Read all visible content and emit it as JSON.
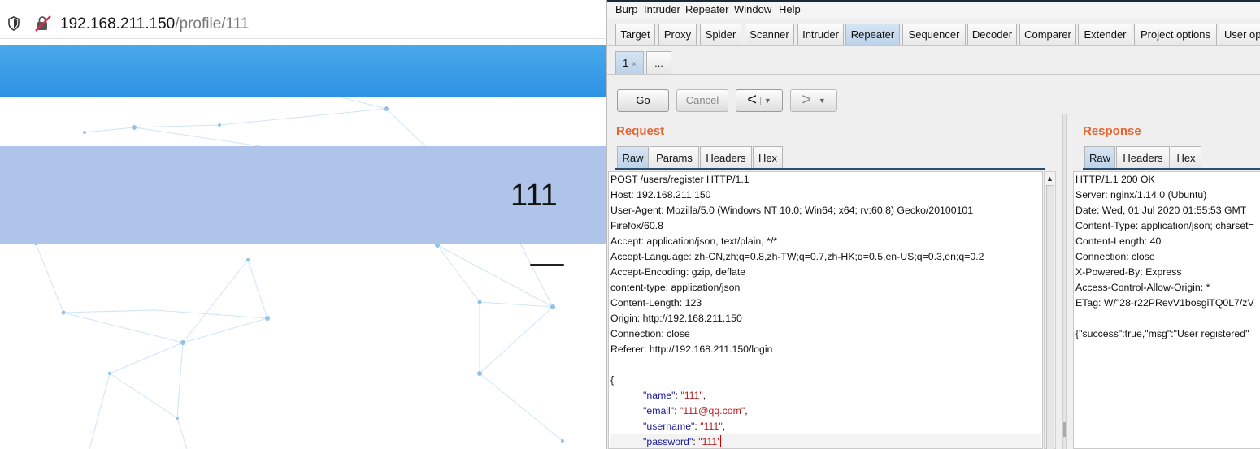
{
  "browser": {
    "url_host": "192.168.211.150",
    "url_path": "/profile/111",
    "profile_name": "111"
  },
  "burp": {
    "menu": [
      "Burp",
      "Intruder",
      "Repeater",
      "Window",
      "Help"
    ],
    "tabs": [
      "Target",
      "Proxy",
      "Spider",
      "Scanner",
      "Intruder",
      "Repeater",
      "Sequencer",
      "Decoder",
      "Comparer",
      "Extender",
      "Project options",
      "User op"
    ],
    "active_tab": "Repeater",
    "repeater_tabs": [
      "1",
      "..."
    ],
    "toolbar": {
      "go": "Go",
      "cancel": "Cancel",
      "back": "<",
      "forward": ">"
    },
    "request": {
      "title": "Request",
      "tabs": [
        "Raw",
        "Params",
        "Headers",
        "Hex"
      ],
      "headers": [
        "POST /users/register HTTP/1.1",
        "Host: 192.168.211.150",
        "User-Agent: Mozilla/5.0 (Windows NT 10.0; Win64; x64; rv:60.8) Gecko/20100101",
        "Firefox/60.8",
        "Accept: application/json, text/plain, */*",
        "Accept-Language: zh-CN,zh;q=0.8,zh-TW;q=0.7,zh-HK;q=0.5,en-US;q=0.3,en;q=0.2",
        "Accept-Encoding: gzip, deflate",
        "content-type: application/json",
        "Content-Length: 123",
        "Origin: http://192.168.211.150",
        "Connection: close",
        "Referer: http://192.168.211.150/login"
      ],
      "body_open": "{",
      "body": [
        {
          "key": "\"name\"",
          "value": "\"111\"",
          "sep": ","
        },
        {
          "key": "\"email\"",
          "value": "\"111@qq.com\"",
          "sep": ","
        },
        {
          "key": "\"username\"",
          "value": "\"111\"",
          "sep": ","
        },
        {
          "key": "\"password\"",
          "value": "\"111'",
          "sep": ""
        }
      ]
    },
    "response": {
      "title": "Response",
      "tabs": [
        "Raw",
        "Headers",
        "Hex"
      ],
      "lines": [
        "HTTP/1.1 200 OK",
        "Server: nginx/1.14.0 (Ubuntu)",
        "Date: Wed, 01 Jul 2020 01:55:53 GMT",
        "Content-Type: application/json; charset=",
        "Content-Length: 40",
        "Connection: close",
        "X-Powered-By: Express",
        "Access-Control-Allow-Origin: *",
        "ETag: W/\"28-r22PRevV1bosgiTQ0L7/zV",
        "",
        "{\"success\":true,\"msg\":\"User registered\""
      ]
    }
  },
  "colors": {
    "header_blue": "#2c92e3",
    "profile_band": "#aec4e9",
    "section_title": "#e8642c",
    "active_tab": "#bcd2ea",
    "json_key": "#1a1a9a",
    "json_value": "#b41e1e"
  },
  "icons": [
    "shield-icon",
    "insecure-connection-icon",
    "tab-close-icon",
    "dropdown-arrow-icon"
  ]
}
